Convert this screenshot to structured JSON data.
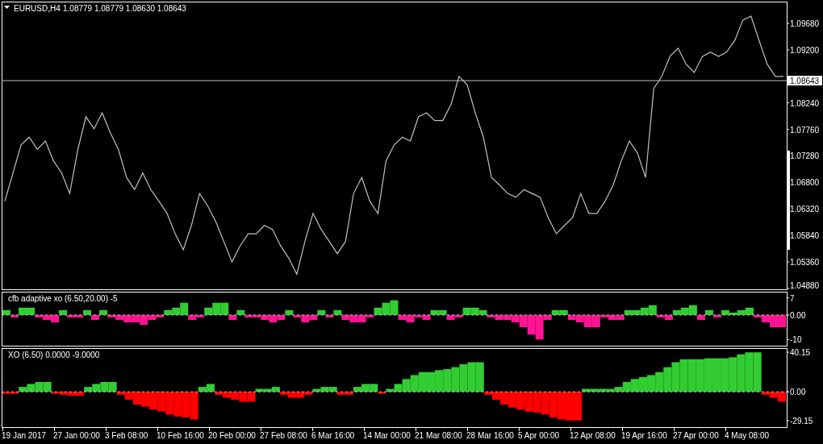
{
  "header": {
    "symbol": "EURUSD,H4",
    "quote": "1.08779 1.08779 1.08630 1.08643"
  },
  "price_pane": {
    "chart_data": {
      "type": "line",
      "ylim": [
        1.04865,
        1.10074
      ],
      "ref_lines": [
        {
          "axis": "y",
          "value": 1.08643,
          "label": "1.08643",
          "color": "#c0c0c0"
        }
      ],
      "yticks": [
        {
          "value": 1.0968,
          "label": "1.09680"
        },
        {
          "value": 1.092,
          "label": "1.09200"
        },
        {
          "value": 1.0824,
          "label": "1.08240"
        },
        {
          "value": 1.0776,
          "label": "1.07760"
        },
        {
          "value": 1.0728,
          "label": "1.07280"
        },
        {
          "value": 1.068,
          "label": "1.06800"
        },
        {
          "value": 1.0632,
          "label": "1.06320"
        },
        {
          "value": 1.0584,
          "label": "1.05840"
        },
        {
          "value": 1.0536,
          "label": "1.05360"
        },
        {
          "value": 1.0488,
          "label": "1.04880"
        }
      ],
      "series": [
        {
          "color": "#c0c0c0",
          "values": [
            1.0646,
            1.0697,
            1.0748,
            1.0762,
            1.074,
            1.0755,
            1.0719,
            1.0697,
            1.066,
            1.074,
            1.0799,
            1.0777,
            1.0806,
            1.077,
            1.074,
            1.0689,
            1.0667,
            1.0697,
            1.0667,
            1.0646,
            1.0624,
            1.0587,
            1.0558,
            1.0602,
            1.066,
            1.0638,
            1.0609,
            1.0573,
            1.0536,
            1.0565,
            1.0587,
            1.0587,
            1.0602,
            1.0595,
            1.0565,
            1.0543,
            1.0514,
            1.0573,
            1.0624,
            1.0595,
            1.0573,
            1.0551,
            1.0573,
            1.066,
            1.0689,
            1.0646,
            1.0624,
            1.0719,
            1.0748,
            1.0762,
            1.0755,
            1.0799,
            1.0806,
            1.0792,
            1.0792,
            1.0821,
            1.0872,
            1.0857,
            1.0806,
            1.0762,
            1.0689,
            1.0675,
            1.066,
            1.0653,
            1.0667,
            1.066,
            1.0653,
            1.0616,
            1.0587,
            1.0602,
            1.0616,
            1.066,
            1.0624,
            1.0624,
            1.0646,
            1.0675,
            1.0719,
            1.0755,
            1.0733,
            1.0689,
            1.085,
            1.0872,
            1.0908,
            1.0923,
            1.0894,
            1.0879,
            1.0908,
            1.0916,
            1.0908,
            1.0916,
            1.0937,
            1.0974,
            1.0981,
            1.0937,
            1.0894,
            1.0872,
            1.0872
          ]
        }
      ]
    }
  },
  "cfb_pane": {
    "title": "cfb adaptive xo (6.50,20.00) -5",
    "chart_data": {
      "type": "bar",
      "stacked": true,
      "ylim": [
        -12.5,
        9.5
      ],
      "yticks": [
        {
          "value": 7,
          "label": "7"
        },
        {
          "value": 0,
          "label": "0.00"
        },
        {
          "value": -10,
          "label": "-10"
        }
      ],
      "series": [
        {
          "color": "#32cd32",
          "values": [
            2,
            null,
            3,
            3,
            null,
            null,
            null,
            2,
            null,
            null,
            2,
            null,
            2,
            null,
            null,
            null,
            null,
            null,
            null,
            null,
            2,
            3,
            5,
            null,
            null,
            3,
            5,
            5,
            null,
            2,
            null,
            null,
            null,
            null,
            null,
            2,
            null,
            null,
            null,
            2,
            null,
            2,
            null,
            null,
            null,
            null,
            3,
            5,
            6,
            null,
            null,
            null,
            null,
            2,
            2,
            null,
            null,
            3,
            3,
            2,
            null,
            null,
            null,
            null,
            null,
            null,
            null,
            null,
            2,
            2,
            null,
            null,
            null,
            null,
            null,
            null,
            null,
            2,
            2,
            3,
            4,
            null,
            null,
            2,
            3,
            4,
            null,
            2,
            null,
            2,
            1,
            2,
            3,
            null,
            null,
            null,
            null
          ]
        },
        {
          "color": "#ff1493",
          "values": [
            null,
            -1,
            null,
            null,
            -1,
            -2,
            -3,
            null,
            -1,
            -1,
            null,
            -2,
            null,
            -1,
            -2,
            -3,
            -3,
            -4,
            -2,
            -1,
            null,
            null,
            null,
            -2,
            -1,
            null,
            null,
            null,
            -2,
            null,
            -1,
            -1,
            -2,
            -3,
            -2,
            null,
            -1,
            -3,
            -2,
            null,
            -1,
            null,
            -2,
            -3,
            -3,
            -1,
            null,
            null,
            null,
            -2,
            -3,
            -1,
            -2,
            null,
            null,
            -2,
            -1,
            null,
            null,
            null,
            -1,
            -2,
            -2,
            -3,
            -5,
            -8,
            -10,
            -2,
            null,
            null,
            -2,
            -3,
            -5,
            -5,
            -1,
            -2,
            -2,
            null,
            null,
            null,
            null,
            -1,
            -2,
            null,
            null,
            null,
            -2,
            null,
            -1,
            null,
            null,
            null,
            null,
            -1,
            -3,
            -5,
            -5
          ]
        }
      ]
    }
  },
  "xo_pane": {
    "title": "XO (6.50) 0.0000 -9.0000",
    "chart_data": {
      "type": "bar",
      "stacked": true,
      "ylim": [
        -35.7,
        44.3
      ],
      "yticks": [
        {
          "value": 40.15,
          "label": "40.15"
        },
        {
          "value": 0,
          "label": "0.00"
        },
        {
          "value": -29.15,
          "label": "-29.15"
        }
      ],
      "series": [
        {
          "color": "#32cd32",
          "values": [
            null,
            null,
            5,
            8,
            10,
            10,
            null,
            null,
            null,
            null,
            5,
            8,
            10,
            10,
            null,
            null,
            null,
            null,
            null,
            null,
            null,
            null,
            null,
            null,
            5,
            8,
            null,
            null,
            null,
            null,
            null,
            3,
            3,
            5,
            null,
            null,
            null,
            null,
            3,
            5,
            5,
            null,
            null,
            5,
            8,
            8,
            null,
            3,
            8,
            13,
            17,
            20,
            20,
            22,
            23,
            25,
            28,
            30,
            30,
            null,
            null,
            null,
            null,
            null,
            null,
            null,
            null,
            null,
            null,
            null,
            null,
            3,
            3,
            3,
            3,
            5,
            10,
            13,
            15,
            17,
            20,
            25,
            30,
            33,
            33,
            33,
            34,
            34,
            34,
            35,
            38,
            40,
            40,
            null,
            null,
            null
          ]
        },
        {
          "color": "#ff0000",
          "values": [
            -2,
            -2,
            null,
            null,
            null,
            null,
            -2,
            -3,
            -4,
            -4,
            null,
            null,
            null,
            null,
            -3,
            -8,
            -13,
            -15,
            -18,
            -20,
            -23,
            -25,
            -26,
            -28,
            null,
            null,
            -3,
            -6,
            -8,
            -10,
            -10,
            null,
            null,
            null,
            -3,
            -6,
            -6,
            -3,
            null,
            null,
            null,
            -3,
            -3,
            null,
            null,
            null,
            -2,
            null,
            null,
            null,
            null,
            null,
            null,
            null,
            null,
            null,
            null,
            null,
            null,
            -3,
            -8,
            -13,
            -16,
            -18,
            -20,
            -21,
            -23,
            -26,
            -28,
            -29,
            -29,
            null,
            null,
            null,
            null,
            null,
            null,
            null,
            null,
            null,
            null,
            null,
            null,
            null,
            null,
            null,
            null,
            null,
            null,
            null,
            null,
            null,
            null,
            -3,
            -6,
            -10
          ]
        }
      ]
    }
  },
  "time_axis": [
    "19 Jan 2017",
    "27 Jan 00:00",
    "3 Feb 08:00",
    "10 Feb 16:00",
    "20 Feb 00:00",
    "27 Feb 08:00",
    "6 Mar 16:00",
    "14 Mar 00:00",
    "21 Mar 08:00",
    "28 Mar 16:00",
    "5 Apr 00:00",
    "12 Apr 08:00",
    "19 Apr 16:00",
    "27 Apr 00:00",
    "4 May 08:00"
  ]
}
